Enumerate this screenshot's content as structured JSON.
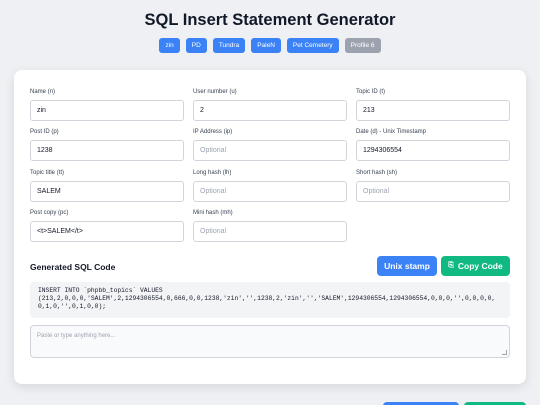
{
  "header": {
    "title": "SQL Insert Statement Generator"
  },
  "profiles": [
    {
      "label": "zin",
      "active": true
    },
    {
      "label": "PD",
      "active": true
    },
    {
      "label": "Tundra",
      "active": true
    },
    {
      "label": "PaleN",
      "active": true
    },
    {
      "label": "Pet Cemetery",
      "active": true
    },
    {
      "label": "Profile 6",
      "active": false
    }
  ],
  "fields": {
    "name": {
      "label": "Name (n)",
      "value": "zin",
      "placeholder": ""
    },
    "user_number": {
      "label": "User number (u)",
      "value": "2",
      "placeholder": ""
    },
    "topic_id": {
      "label": "Topic ID (t)",
      "value": "213",
      "placeholder": ""
    },
    "post_id": {
      "label": "Post ID (p)",
      "value": "1238",
      "placeholder": ""
    },
    "ip_address": {
      "label": "IP Address (ip)",
      "value": "",
      "placeholder": "Optional"
    },
    "date": {
      "label": "Date (d) - Unix Timestamp",
      "value": "1294306554",
      "placeholder": ""
    },
    "topic_title": {
      "label": "Topic title (tt)",
      "value": "SALEM",
      "placeholder": ""
    },
    "long_hash": {
      "label": "Long hash (lh)",
      "value": "",
      "placeholder": "Optional"
    },
    "short_hash": {
      "label": "Short hash (sh)",
      "value": "",
      "placeholder": "Optional"
    },
    "post_copy": {
      "label": "Post copy (pc)",
      "value": "<t>SALEM</t>",
      "placeholder": ""
    },
    "mini_hash": {
      "label": "Mini hash (mh)",
      "value": "",
      "placeholder": "Optional"
    }
  },
  "output": {
    "title": "Generated SQL Code",
    "unix_button": "Unix stamp",
    "copy_button": "Copy Code",
    "copy_icon": "copy-icon",
    "sql": "INSERT INTO `phpbb_topics` VALUES\n(213,2,0,0,0,'SALEM',2,1294306554,0,666,0,0,1238,'zin','',1238,2,'zin','','SALEM',1294306554,1294306554,0,0,0,'',0,0,0,0,0,1,0,'',0,1,0,0);",
    "paste_placeholder": "Paste or type anything here..."
  },
  "colors": {
    "primary": "#3b82f6",
    "success": "#10b981",
    "inactive": "#9ca3af"
  }
}
